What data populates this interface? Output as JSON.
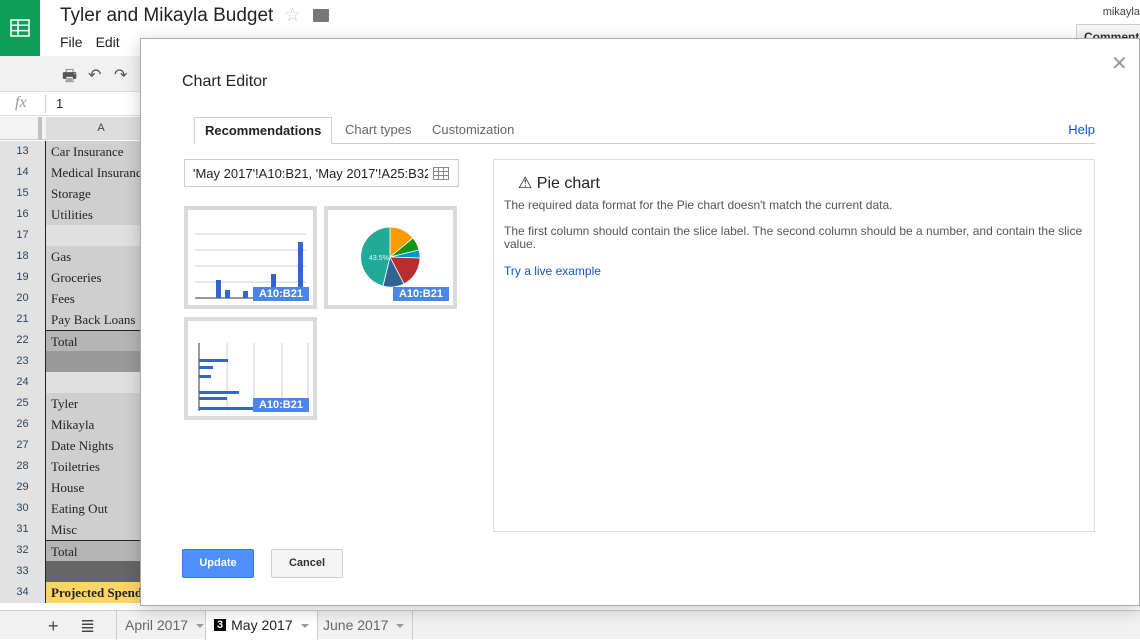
{
  "app": {
    "title": "Tyler and Mikayla Budget",
    "user": "mikayla",
    "comments_label": "Comments",
    "icons": [
      "sheets-logo-icon",
      "star-icon",
      "folder-icon"
    ]
  },
  "menu": [
    "File",
    "Edit"
  ],
  "formula": {
    "value": "1"
  },
  "column_header": "A",
  "rows": [
    {
      "num": "13",
      "text": "Car Insurance",
      "style": "normal"
    },
    {
      "num": "14",
      "text": "Medical Insurance",
      "style": "normal"
    },
    {
      "num": "15",
      "text": "Storage",
      "style": "normal"
    },
    {
      "num": "16",
      "text": "Utilities",
      "style": "normal"
    },
    {
      "num": "17",
      "text": "",
      "style": "light"
    },
    {
      "num": "18",
      "text": "Gas",
      "style": "normal"
    },
    {
      "num": "19",
      "text": "Groceries",
      "style": "normal"
    },
    {
      "num": "20",
      "text": "Fees",
      "style": "normal"
    },
    {
      "num": "21",
      "text": "Pay Back Loans",
      "style": "normal"
    },
    {
      "num": "22",
      "text": "Total",
      "style": "total"
    },
    {
      "num": "23",
      "text": "",
      "style": "dark"
    },
    {
      "num": "24",
      "text": "",
      "style": "light"
    },
    {
      "num": "25",
      "text": "Tyler",
      "style": "normal"
    },
    {
      "num": "26",
      "text": "Mikayla",
      "style": "normal"
    },
    {
      "num": "27",
      "text": "Date Nights",
      "style": "normal"
    },
    {
      "num": "28",
      "text": "Toiletries",
      "style": "normal"
    },
    {
      "num": "29",
      "text": "House",
      "style": "normal"
    },
    {
      "num": "30",
      "text": "Eating Out",
      "style": "normal"
    },
    {
      "num": "31",
      "text": "Misc",
      "style": "normal"
    },
    {
      "num": "32",
      "text": "Total",
      "style": "total"
    },
    {
      "num": "33",
      "text": "",
      "style": "darker"
    },
    {
      "num": "34",
      "text": "Projected Spending",
      "style": "proj"
    }
  ],
  "sheets": [
    {
      "label": "April 2017",
      "active": false
    },
    {
      "label": "May 2017",
      "active": true,
      "badge": "3"
    },
    {
      "label": "June 2017",
      "active": false
    }
  ],
  "dialog": {
    "title": "Chart Editor",
    "tabs": [
      "Recommendations",
      "Chart types",
      "Customization"
    ],
    "help": "Help",
    "range": "'May 2017'!A10:B21, 'May 2017'!A25:B32",
    "thumb_label": "A10:B21",
    "pie_pct": "43.5%",
    "panel": {
      "title": "Pie chart",
      "line1": "The required data format for the Pie chart doesn't match the current data.",
      "line2": "The first column should contain the slice label. The second column should be a number, and contain the slice value.",
      "link": "Try a live example"
    },
    "update": "Update",
    "cancel": "Cancel"
  },
  "colors": {
    "accent": "#4a86e8",
    "brand": "#0f9d58",
    "link": "#1155cc"
  }
}
